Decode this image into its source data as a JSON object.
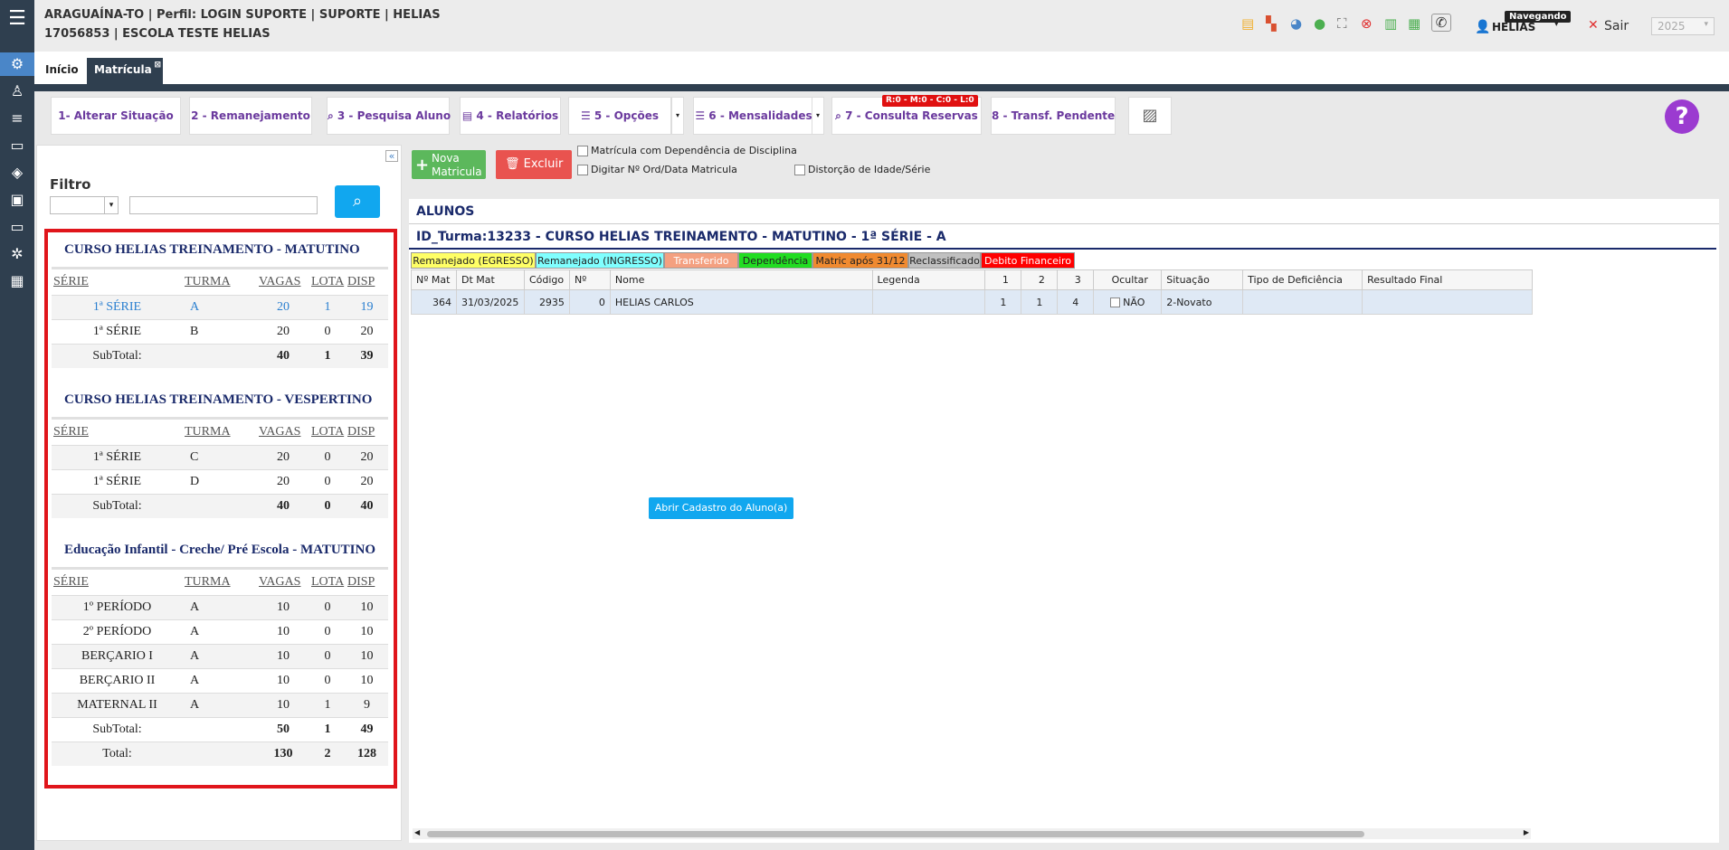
{
  "header": {
    "line1": "ARAGUAÍNA-TO | Perfil: LOGIN SUPORTE | SUPORTE | HELIAS",
    "line2": "17056853 | ESCOLA TESTE HELIAS",
    "user": "HELIAS",
    "browse_badge": "Navegando",
    "logout": "Sair",
    "year": "2025"
  },
  "tabs": [
    "Início",
    "Matrícula"
  ],
  "toolbar": {
    "b1": "1- Alterar Situação",
    "b2": "2 - Remanejamento",
    "b3": "3 - Pesquisa Aluno",
    "b4": "4 - Relatórios",
    "b5": "5 - Opções",
    "b6": "6 - Mensalidades",
    "b7": "7 - Consulta Reservas",
    "b7_badge": "R:0 - M:0 - C:0 - L:0",
    "b8": "8 - Transf. Pendente",
    "help": "?"
  },
  "filter": {
    "label": "Filtro"
  },
  "headers": [
    "SÉRIE",
    "TURMA",
    "VAGAS",
    "LOTA",
    "DISP"
  ],
  "groups": [
    {
      "title": "CURSO HELIAS TREINAMENTO - MATUTINO",
      "rows": [
        [
          "1ª SÉRIE",
          "A",
          "20",
          "1",
          "19"
        ],
        [
          "1ª SÉRIE",
          "B",
          "20",
          "0",
          "20"
        ]
      ],
      "sub": [
        "SubTotal:",
        "",
        "40",
        "1",
        "39"
      ]
    },
    {
      "title": "CURSO HELIAS TREINAMENTO - VESPERTINO",
      "rows": [
        [
          "1ª SÉRIE",
          "C",
          "20",
          "0",
          "20"
        ],
        [
          "1ª SÉRIE",
          "D",
          "20",
          "0",
          "20"
        ]
      ],
      "sub": [
        "SubTotal:",
        "",
        "40",
        "0",
        "40"
      ]
    },
    {
      "title": "Educação Infantil - Creche/ Pré Escola - MATUTINO",
      "rows": [
        [
          "1º PERÍODO",
          "A",
          "10",
          "0",
          "10"
        ],
        [
          "2º PERÍODO",
          "A",
          "10",
          "0",
          "10"
        ],
        [
          "BERÇARIO I",
          "A",
          "10",
          "0",
          "10"
        ],
        [
          "BERÇARIO II",
          "A",
          "10",
          "0",
          "10"
        ],
        [
          "MATERNAL II",
          "A",
          "10",
          "1",
          "9"
        ]
      ],
      "sub": [
        "SubTotal:",
        "",
        "50",
        "1",
        "49"
      ],
      "total": [
        "Total:",
        "",
        "130",
        "2",
        "128"
      ]
    }
  ],
  "actions": {
    "new_line1": "Nova",
    "new_line2": "Matricula",
    "delete": "Excluir",
    "chk1": "Matrícula com Dependência de Disciplina",
    "chk2": "Digitar Nº Ord/Data Matricula",
    "chk3": "Distorção de Idade/Série"
  },
  "panel": {
    "title": "ALUNOS",
    "turma": "ID_Turma:13233 - CURSO HELIAS TREINAMENTO - MATUTINO - 1ª SÉRIE - A",
    "open_btn": "Abrir Cadastro do Aluno(a)"
  },
  "legend": [
    {
      "label": "Remanejado (EGRESSO)",
      "color": "#ffff66"
    },
    {
      "label": "Remanejado (INGRESSO)",
      "color": "#80ffff"
    },
    {
      "label": "Transferido",
      "color": "#f4a080"
    },
    {
      "label": "Dependência",
      "color": "#22dd22"
    },
    {
      "label": "Matric após 31/12",
      "color": "#f08a30"
    },
    {
      "label": "Reclassificado",
      "color": "#c0c0c0"
    },
    {
      "label": "Debito Financeiro",
      "color": "#ff0000"
    }
  ],
  "columns": [
    "Nº Mat",
    "Dt Mat",
    "Código",
    "Nº",
    "Nome",
    "Legenda",
    "1",
    "2",
    "3",
    "Ocultar",
    "Situação",
    "Tipo de Deficiência",
    "Resultado Final"
  ],
  "student": [
    "364",
    "31/03/2025",
    "2935",
    "0",
    "HELIAS CARLOS",
    "",
    "1",
    "1",
    "4",
    "NÃO",
    "2-Novato",
    "",
    ""
  ]
}
